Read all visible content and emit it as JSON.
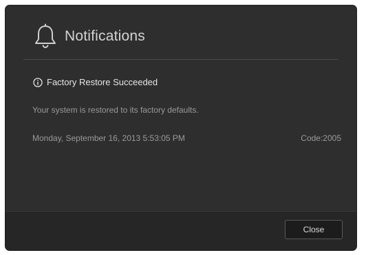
{
  "dialog": {
    "title": "Notifications",
    "icon": "bell-icon"
  },
  "notification": {
    "title_icon": "info-icon",
    "title": "Factory Restore Succeeded",
    "body": "Your system is restored to its factory defaults.",
    "timestamp": "Monday, September 16, 2013 5:53:05 PM",
    "code": "Code:2005"
  },
  "footer": {
    "close_label": "Close"
  },
  "colors": {
    "dialog_bg": "#2e2e2e",
    "footer_bg": "#262626",
    "title_text": "#d4d4d4",
    "muted_text": "#9a9a9a"
  }
}
